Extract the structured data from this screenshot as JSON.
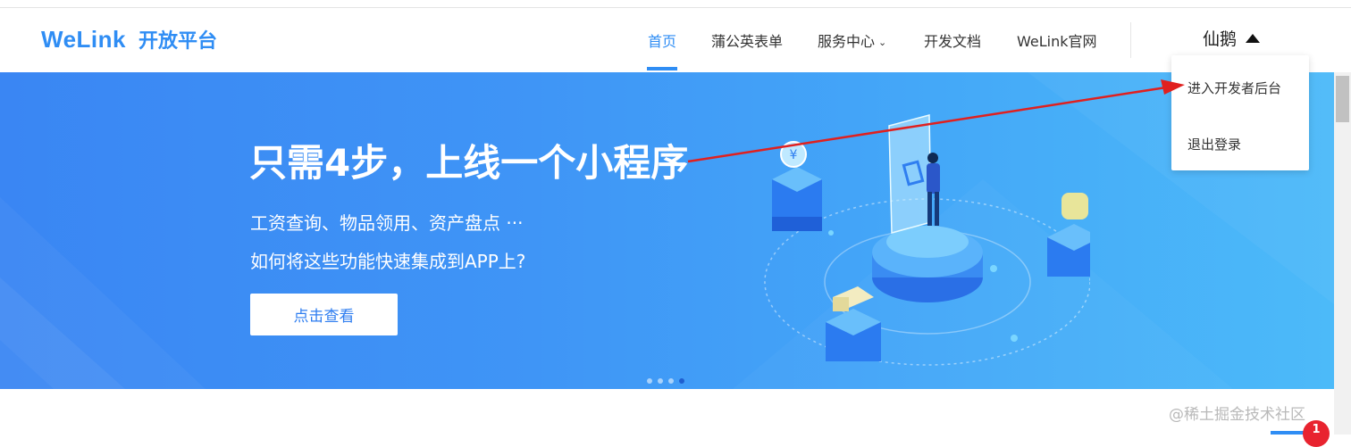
{
  "header": {
    "logo_brand": "WeLink",
    "logo_sub": "开放平台",
    "nav": [
      {
        "label": "首页",
        "active": true
      },
      {
        "label": "蒲公英表单"
      },
      {
        "label": "服务中心",
        "caret": "⌄"
      },
      {
        "label": "开发文档"
      },
      {
        "label": "WeLink官网"
      }
    ],
    "user_name": "仙鹅",
    "user_icon": "caret-up-icon"
  },
  "dropdown": {
    "items": [
      {
        "label": "进入开发者后台"
      },
      {
        "label": "退出登录"
      }
    ]
  },
  "banner": {
    "headline": "只需4步，上线一个小程序",
    "sub1": "工资查询、物品领用、资产盘点 ···",
    "sub2": "如何将这些功能快速集成到APP上?",
    "cta": "点击查看",
    "dots": [
      false,
      false,
      false,
      true
    ]
  },
  "watermark": "@稀土掘金技术社区",
  "notification_count": "1",
  "colors": {
    "accent": "#2f8df4",
    "banner_start": "#3a86f3",
    "banner_end": "#4cbaf9",
    "arrow": "#e0201f",
    "badge": "#e8232f"
  }
}
